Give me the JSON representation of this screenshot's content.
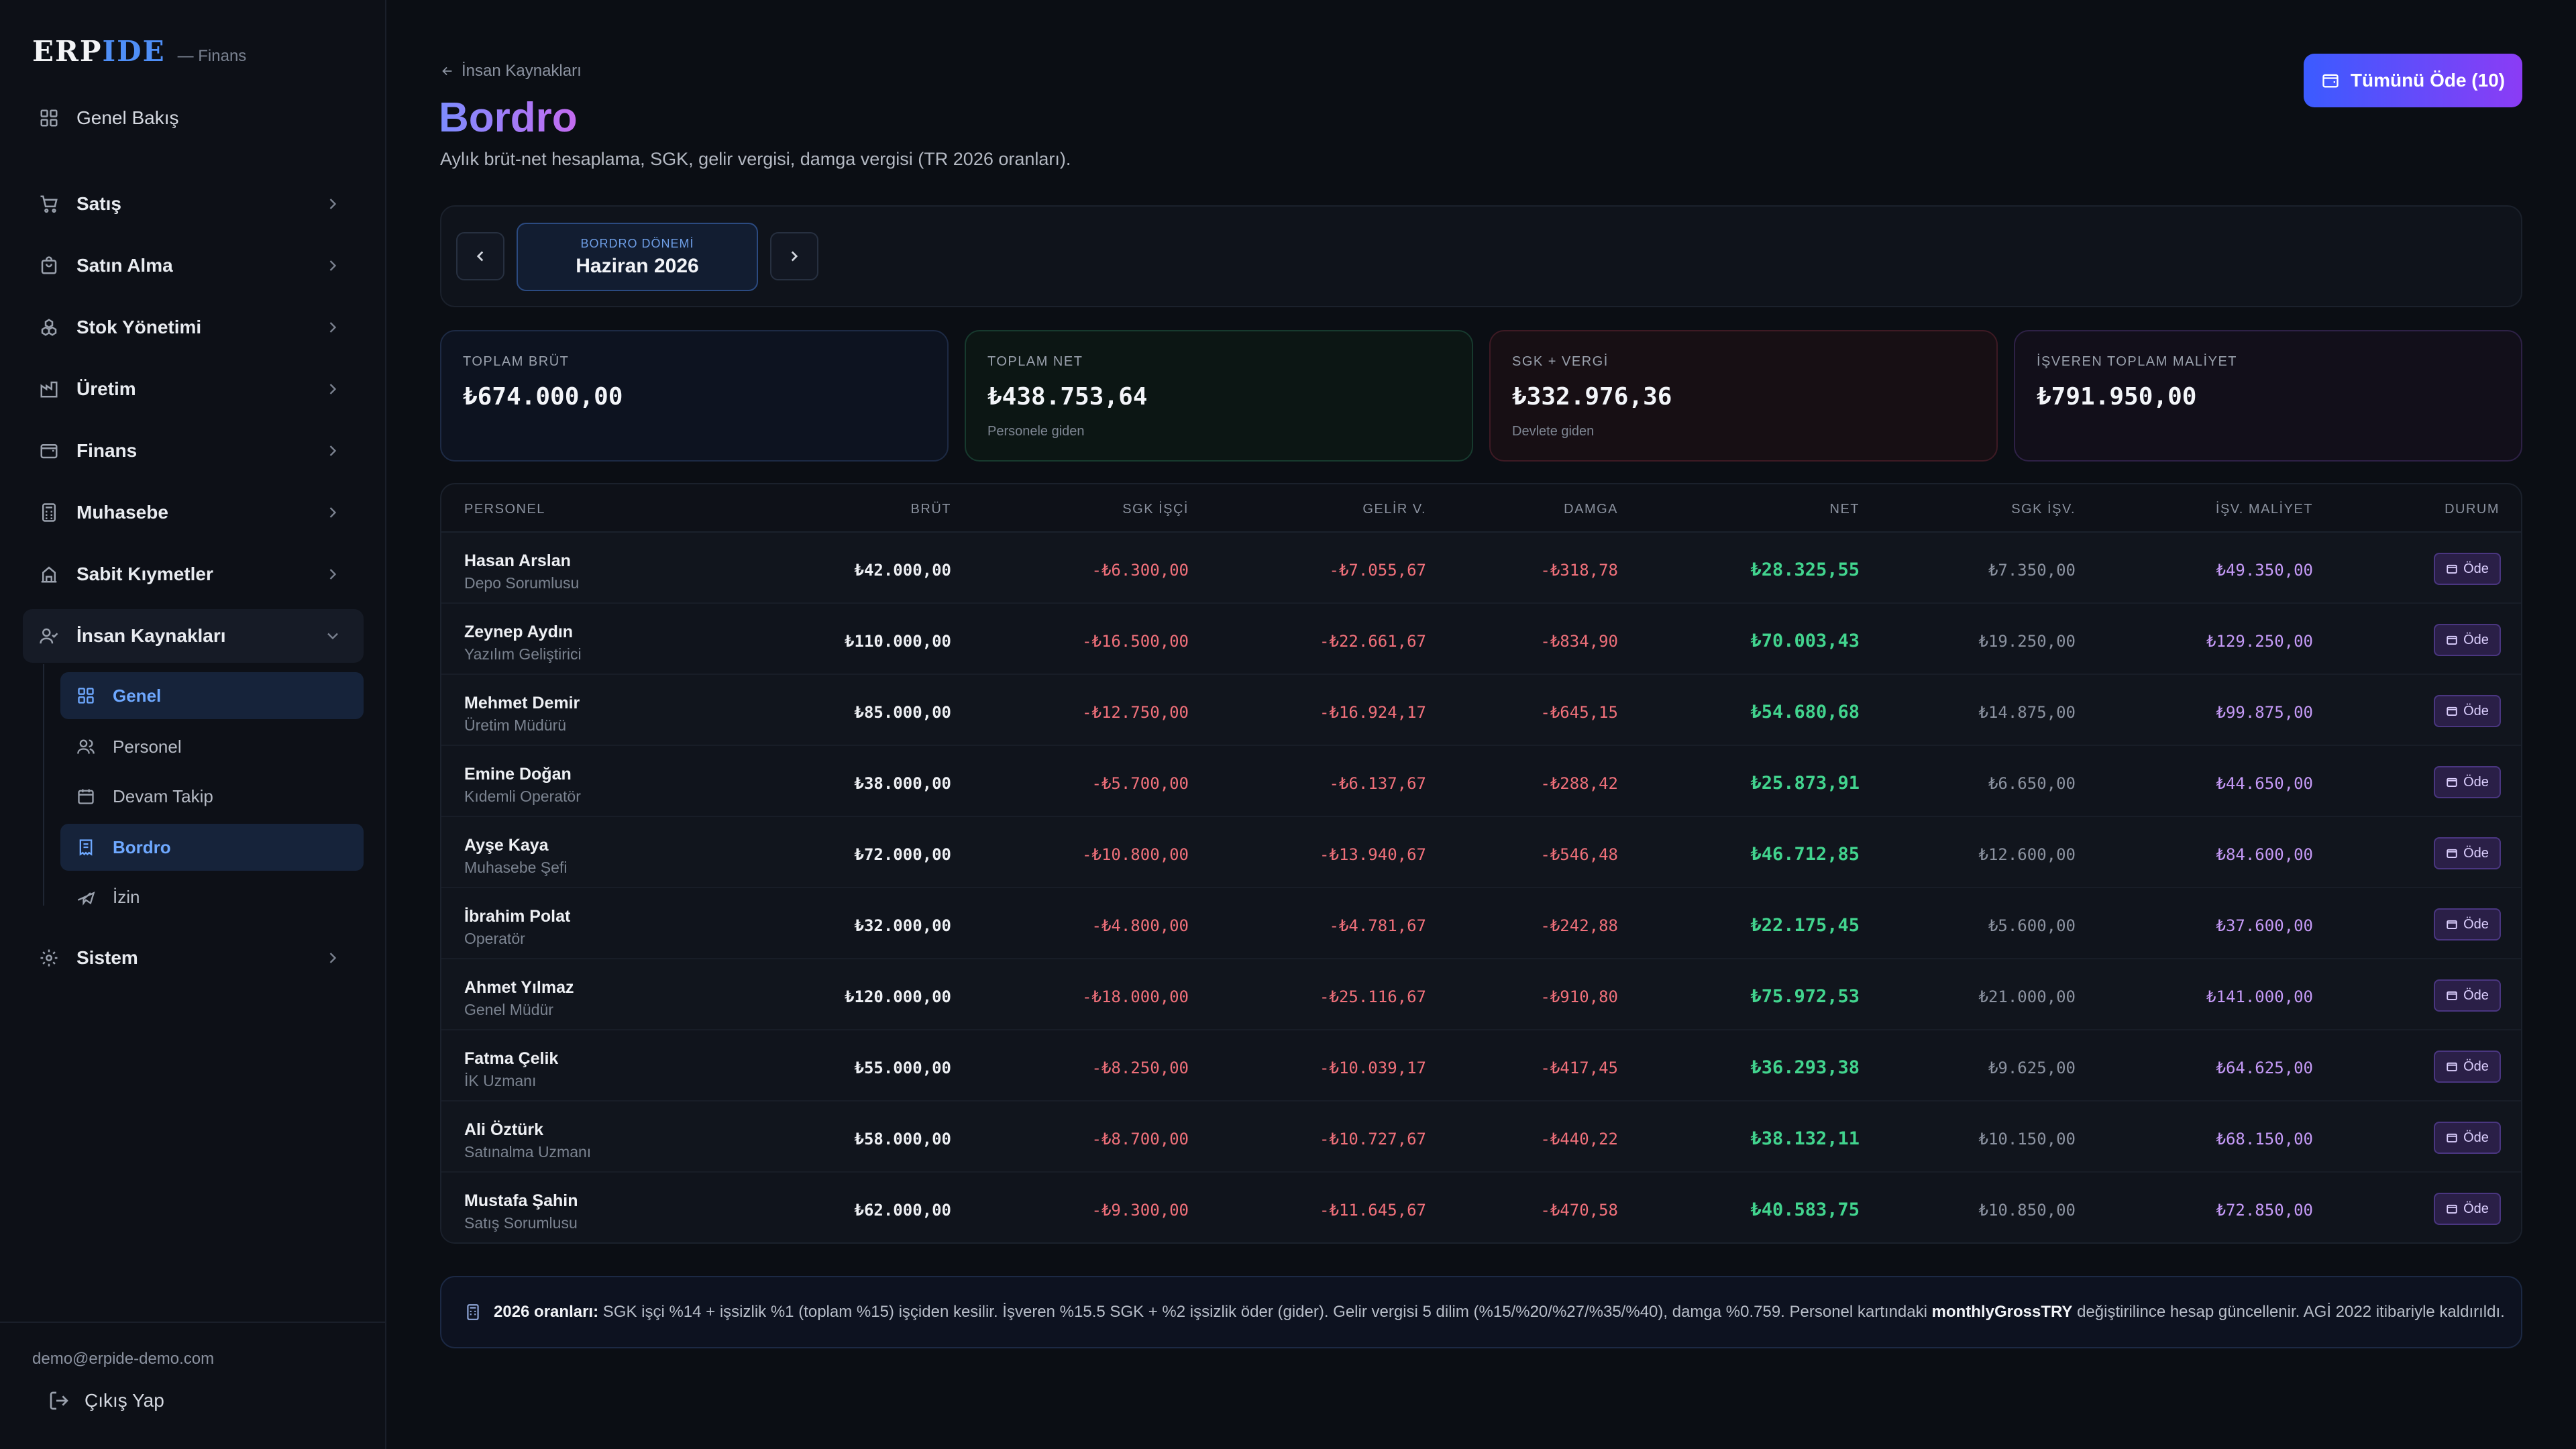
{
  "brand": {
    "logo_a": "ERP",
    "logo_b": "IDE",
    "sub": "— Finans"
  },
  "sidebar": {
    "items": [
      {
        "label": "Genel Bakış",
        "icon": "dashboard-icon"
      },
      {
        "label": "Satış",
        "icon": "cart-icon"
      },
      {
        "label": "Satın Alma",
        "icon": "bag-icon"
      },
      {
        "label": "Stok Yönetimi",
        "icon": "boxes-icon"
      },
      {
        "label": "Üretim",
        "icon": "factory-icon"
      },
      {
        "label": "Finans",
        "icon": "wallet-icon"
      },
      {
        "label": "Muhasebe",
        "icon": "calculator-icon"
      },
      {
        "label": "Sabit Kıymetler",
        "icon": "building-icon"
      },
      {
        "label": "İnsan Kaynakları",
        "icon": "users-icon"
      },
      {
        "label": "Sistem",
        "icon": "gear-icon"
      }
    ],
    "sub_items": [
      {
        "label": "Genel",
        "icon": "grid-icon"
      },
      {
        "label": "Personel",
        "icon": "users-icon"
      },
      {
        "label": "Devam Takip",
        "icon": "calendar-icon"
      },
      {
        "label": "Bordro",
        "icon": "receipt-icon"
      },
      {
        "label": "İzin",
        "icon": "plane-icon"
      }
    ],
    "user_email": "demo@erpide-demo.com",
    "logout_label": "Çıkış Yap"
  },
  "header": {
    "breadcrumb": "İnsan Kaynakları",
    "title": "Bordro",
    "subtitle": "Aylık brüt-net hesaplama, SGK, gelir vergisi, damga vergisi (TR 2026 oranları).",
    "pay_all_label": "Tümünü Öde (10)"
  },
  "period": {
    "label": "BORDRO DÖNEMİ",
    "value": "Haziran 2026"
  },
  "stats": [
    {
      "label": "TOPLAM BRÜT",
      "value": "₺674.000,00",
      "note": ""
    },
    {
      "label": "TOPLAM NET",
      "value": "₺438.753,64",
      "note": "Personele giden"
    },
    {
      "label": "SGK + VERGİ",
      "value": "₺332.976,36",
      "note": "Devlete giden"
    },
    {
      "label": "İŞVEREN TOPLAM MALİYET",
      "value": "₺791.950,00",
      "note": ""
    }
  ],
  "table": {
    "headers": [
      "PERSONEL",
      "BRÜT",
      "SGK İŞÇİ",
      "GELİR V.",
      "DAMGA",
      "NET",
      "SGK İŞV.",
      "İŞV. MALİYET",
      "DURUM"
    ],
    "pay_label": "Öde",
    "rows": [
      {
        "name": "Hasan Arslan",
        "role": "Depo Sorumlusu",
        "brut": "₺42.000,00",
        "sgk": "-₺6.300,00",
        "gelir": "-₺7.055,67",
        "damga": "-₺318,78",
        "net": "₺28.325,55",
        "sgk_isv": "₺7.350,00",
        "isv": "₺49.350,00"
      },
      {
        "name": "Zeynep Aydın",
        "role": "Yazılım Geliştirici",
        "brut": "₺110.000,00",
        "sgk": "-₺16.500,00",
        "gelir": "-₺22.661,67",
        "damga": "-₺834,90",
        "net": "₺70.003,43",
        "sgk_isv": "₺19.250,00",
        "isv": "₺129.250,00"
      },
      {
        "name": "Mehmet Demir",
        "role": "Üretim Müdürü",
        "brut": "₺85.000,00",
        "sgk": "-₺12.750,00",
        "gelir": "-₺16.924,17",
        "damga": "-₺645,15",
        "net": "₺54.680,68",
        "sgk_isv": "₺14.875,00",
        "isv": "₺99.875,00"
      },
      {
        "name": "Emine Doğan",
        "role": "Kıdemli Operatör",
        "brut": "₺38.000,00",
        "sgk": "-₺5.700,00",
        "gelir": "-₺6.137,67",
        "damga": "-₺288,42",
        "net": "₺25.873,91",
        "sgk_isv": "₺6.650,00",
        "isv": "₺44.650,00"
      },
      {
        "name": "Ayşe Kaya",
        "role": "Muhasebe Şefi",
        "brut": "₺72.000,00",
        "sgk": "-₺10.800,00",
        "gelir": "-₺13.940,67",
        "damga": "-₺546,48",
        "net": "₺46.712,85",
        "sgk_isv": "₺12.600,00",
        "isv": "₺84.600,00"
      },
      {
        "name": "İbrahim Polat",
        "role": "Operatör",
        "brut": "₺32.000,00",
        "sgk": "-₺4.800,00",
        "gelir": "-₺4.781,67",
        "damga": "-₺242,88",
        "net": "₺22.175,45",
        "sgk_isv": "₺5.600,00",
        "isv": "₺37.600,00"
      },
      {
        "name": "Ahmet Yılmaz",
        "role": "Genel Müdür",
        "brut": "₺120.000,00",
        "sgk": "-₺18.000,00",
        "gelir": "-₺25.116,67",
        "damga": "-₺910,80",
        "net": "₺75.972,53",
        "sgk_isv": "₺21.000,00",
        "isv": "₺141.000,00"
      },
      {
        "name": "Fatma Çelik",
        "role": "İK Uzmanı",
        "brut": "₺55.000,00",
        "sgk": "-₺8.250,00",
        "gelir": "-₺10.039,17",
        "damga": "-₺417,45",
        "net": "₺36.293,38",
        "sgk_isv": "₺9.625,00",
        "isv": "₺64.625,00"
      },
      {
        "name": "Ali Öztürk",
        "role": "Satınalma Uzmanı",
        "brut": "₺58.000,00",
        "sgk": "-₺8.700,00",
        "gelir": "-₺10.727,67",
        "damga": "-₺440,22",
        "net": "₺38.132,11",
        "sgk_isv": "₺10.150,00",
        "isv": "₺68.150,00"
      },
      {
        "name": "Mustafa Şahin",
        "role": "Satış Sorumlusu",
        "brut": "₺62.000,00",
        "sgk": "-₺9.300,00",
        "gelir": "-₺11.645,67",
        "damga": "-₺470,58",
        "net": "₺40.583,75",
        "sgk_isv": "₺10.850,00",
        "isv": "₺72.850,00"
      }
    ]
  },
  "info": {
    "bold_prefix": "2026 oranları:",
    "text_a": "SGK işçi %14 + işsizlik %1 (toplam %15) işçiden kesilir. İşveren %15.5 SGK + %2 işsizlik öder (gider). Gelir vergisi 5 dilim (%15/%20/%27/%35/%40), damga %0.759. Personel kartındaki",
    "bold_mid": "monthlyGrossTRY",
    "text_b": "değiştirilince hesap güncellenir. AGİ 2022 itibariyle kaldırıldı."
  }
}
